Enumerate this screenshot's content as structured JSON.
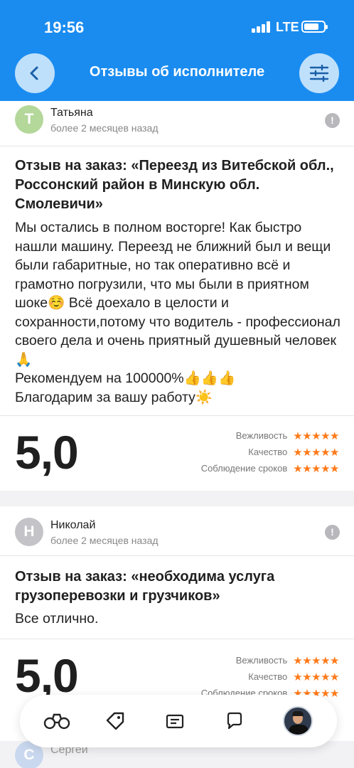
{
  "status": {
    "time": "19:56",
    "network": "LTE"
  },
  "nav": {
    "title": "Отзывы об исполнителе",
    "back_icon": "chevron-left-icon",
    "filter_icon": "sliders-icon"
  },
  "colors": {
    "primary": "#1a8cf0",
    "star": "#ff7a1a"
  },
  "reviews": [
    {
      "initial": "Т",
      "avatar_color": "#b4d79a",
      "name": "Татьяна",
      "date": "более 2 месяцев назад",
      "report_label": "!",
      "order_title": "Отзыв на заказ: «Переезд из Витебской обл., Россонский район в Минскую обл. Смолевичи»",
      "text": "Мы остались в полном восторге! Как быстро нашли машину. Переезд не ближний был и вещи были габаритные, но так оперативно всё и грамотно погрузили, что мы были в приятном шоке☺️ Всё доехало в целости и сохранности,потому что водитель - профессионал своего дела и очень приятный душевный человек🙏\nРекомендуем на 100000%👍👍👍\nБлагодарим за вашу работу☀️",
      "score": "5,0",
      "ratings": [
        {
          "label": "Вежливость",
          "stars": "★★★★★",
          "value": 5
        },
        {
          "label": "Качество",
          "stars": "★★★★★",
          "value": 5
        },
        {
          "label": "Соблюдение сроков",
          "stars": "★★★★★",
          "value": 5
        }
      ]
    },
    {
      "initial": "Н",
      "avatar_color": "#c4c4c8",
      "name": "Николай",
      "date": "более 2 месяцев назад",
      "report_label": "!",
      "order_title": "Отзыв на заказ: «необходима услуга грузоперевозки и грузчиков»",
      "text": "Все отлично.",
      "score": "5,0",
      "ratings": [
        {
          "label": "Вежливость",
          "stars": "★★★★★",
          "value": 5
        },
        {
          "label": "Качество",
          "stars": "★★★★★",
          "value": 5
        },
        {
          "label": "Соблюдение сроков",
          "stars": "★★★★★",
          "value": 5
        }
      ]
    }
  ],
  "peek": {
    "initial": "С",
    "name": "Сергей"
  },
  "tabbar": {
    "items": [
      {
        "icon": "binoculars-icon"
      },
      {
        "icon": "tag-icon"
      },
      {
        "icon": "orders-icon"
      },
      {
        "icon": "chat-icon"
      },
      {
        "icon": "profile-avatar"
      }
    ]
  }
}
